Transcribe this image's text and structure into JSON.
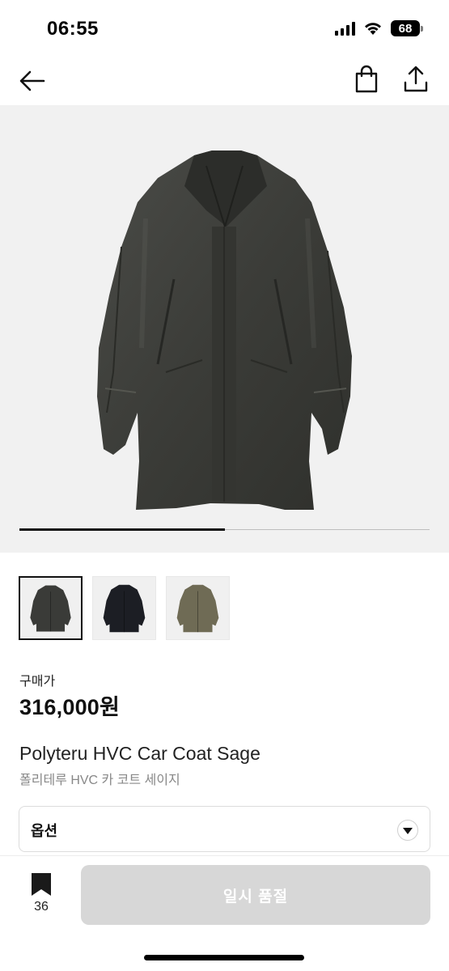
{
  "status_bar": {
    "time": "06:55",
    "battery": "68"
  },
  "nav": {
    "back_icon": "arrow-left-icon",
    "bag_icon": "shopping-bag-icon",
    "share_icon": "share-icon"
  },
  "gallery": {
    "progress": 0.5,
    "thumbnails": [
      {
        "color": "#3a3b38",
        "selected": true
      },
      {
        "color": "#1c1e24",
        "selected": false
      },
      {
        "color": "#6f6b55",
        "selected": false
      }
    ]
  },
  "product": {
    "price_label": "구매가",
    "price": "316,000원",
    "name_en": "Polyteru HVC Car Coat Sage",
    "name_ko": "폴리테루 HVC 카 코트 세이지"
  },
  "option": {
    "label": "옵션"
  },
  "bottom_bar": {
    "bookmark_count": "36",
    "button_label": "일시 품절"
  }
}
